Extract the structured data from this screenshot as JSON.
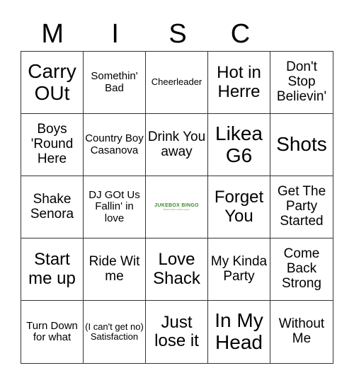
{
  "header": {
    "letters": [
      "M",
      "I",
      "S",
      "C",
      ""
    ]
  },
  "cells": [
    {
      "text": "Carry OUt",
      "size": "xl"
    },
    {
      "text": "Somethin' Bad",
      "size": "s"
    },
    {
      "text": "Cheerleader",
      "size": "xs"
    },
    {
      "text": "Hot in Herre",
      "size": "l"
    },
    {
      "text": "Don't Stop Believin'",
      "size": "m"
    },
    {
      "text": "Boys 'Round Here",
      "size": "m"
    },
    {
      "text": "Country Boy Casanova",
      "size": "s"
    },
    {
      "text": "Drink You away",
      "size": "m"
    },
    {
      "text": "Likea G6",
      "size": "xl"
    },
    {
      "text": "Shots",
      "size": "xl"
    },
    {
      "text": "Shake Senora",
      "size": "m"
    },
    {
      "text": "DJ GOt Us Fallin' in love",
      "size": "s"
    },
    {
      "free": true,
      "logo_text": "JUKEBOX BINGO",
      "logo_subtext": "BINGO WITH SONG ALLEY"
    },
    {
      "text": "Forget You",
      "size": "l"
    },
    {
      "text": "Get The Party Started",
      "size": "m"
    },
    {
      "text": "Start me up",
      "size": "l"
    },
    {
      "text": "Ride Wit me",
      "size": "m"
    },
    {
      "text": "Love Shack",
      "size": "l"
    },
    {
      "text": "My Kinda Party",
      "size": "m"
    },
    {
      "text": "Come Back Strong",
      "size": "m"
    },
    {
      "text": "Turn Down for what",
      "size": "s"
    },
    {
      "text": "(I can't get no) Satisfaction",
      "size": "xs"
    },
    {
      "text": "Just lose it",
      "size": "l"
    },
    {
      "text": "In My Head",
      "size": "xl"
    },
    {
      "text": "Without Me",
      "size": "m"
    }
  ]
}
